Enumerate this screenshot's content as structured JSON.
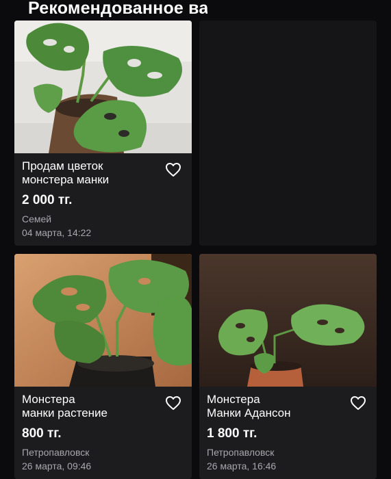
{
  "section": {
    "title": "Рекомендованное ва"
  },
  "listings": [
    {
      "title_line1": "Продам цветок",
      "title_line2": "монстера манки",
      "price": "2 000 тг.",
      "city": "Семей",
      "date": "04 марта, 14:22",
      "favorite_icon": "heart-outline-icon"
    },
    {
      "title_line1": "Монстера",
      "title_line2": "манки растение",
      "price": "800 тг.",
      "city": "Петропавловск",
      "date": "26 марта, 09:46",
      "favorite_icon": "heart-outline-icon"
    },
    {
      "title_line1": "Монстера",
      "title_line2": "Манки Адансон",
      "price": "1 800 тг.",
      "city": "Петропавловск",
      "date": "26 марта, 16:46",
      "favorite_icon": "heart-outline-icon"
    }
  ],
  "colors": {
    "background": "#0b0b0d",
    "card": "#1c1c1f",
    "secondary_text": "#a7a7ad",
    "leaf": "#4f8a3a"
  }
}
